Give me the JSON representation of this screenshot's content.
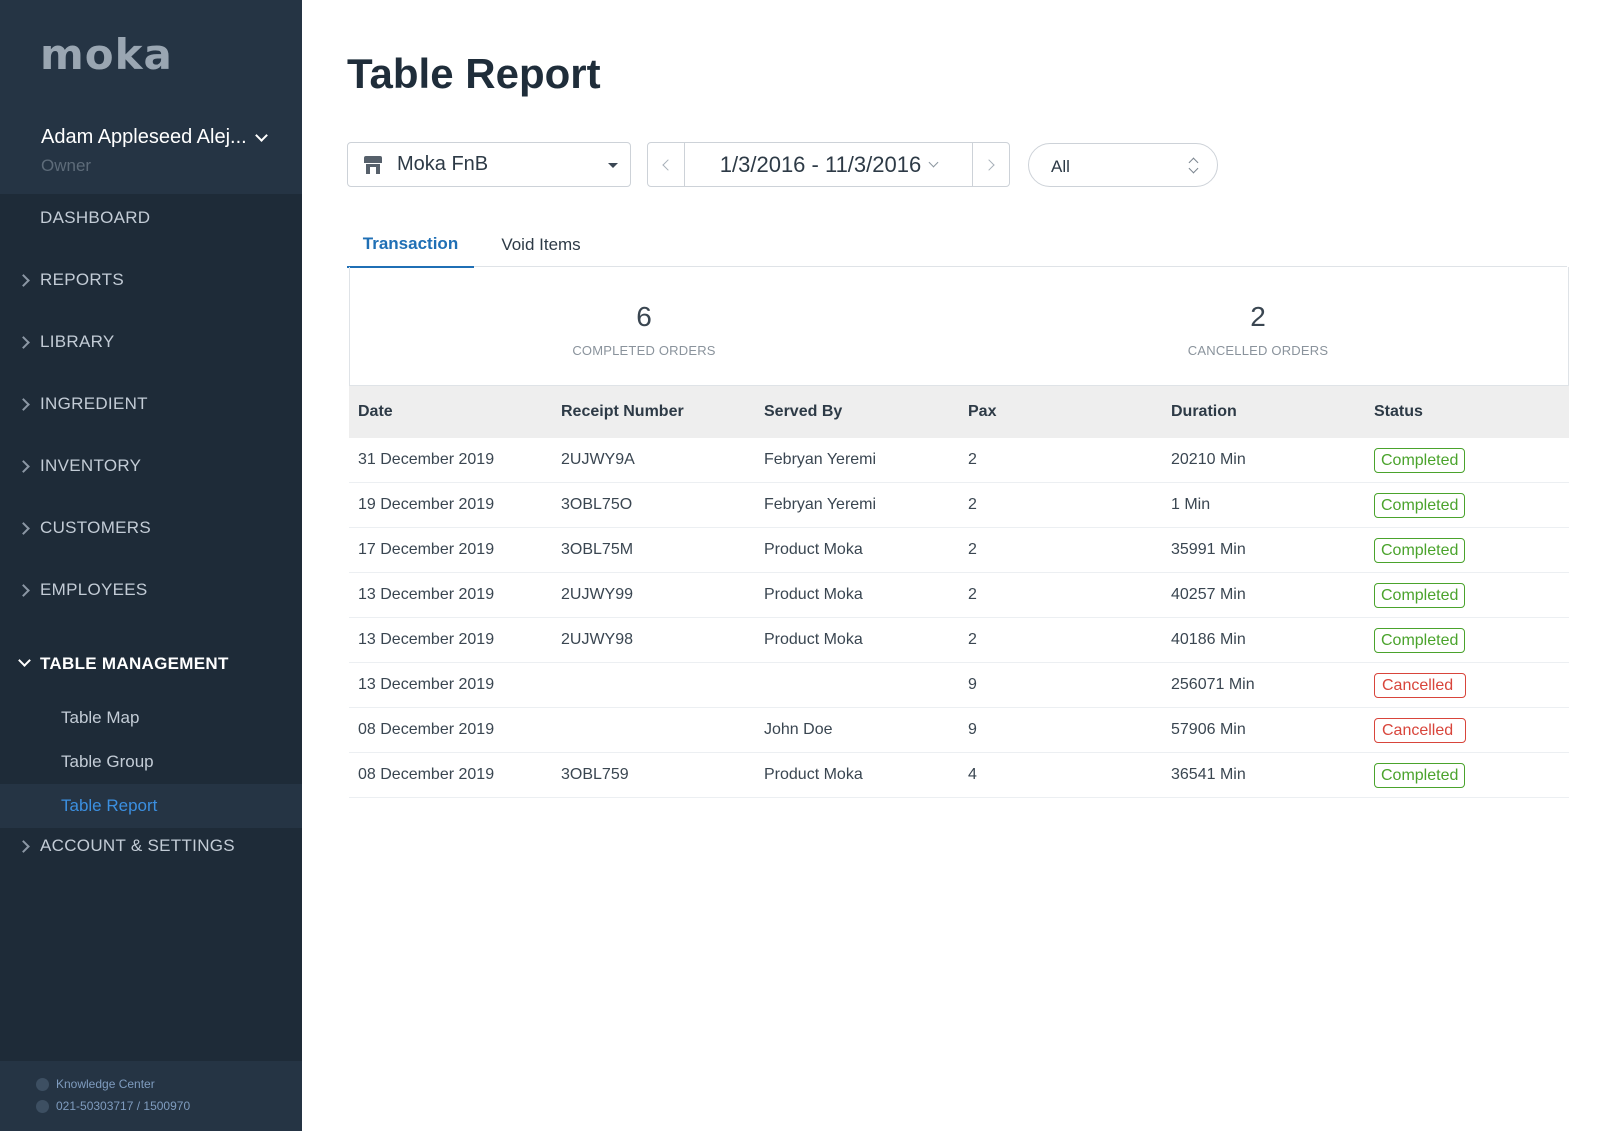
{
  "sidebar": {
    "logo": "moka",
    "user_name": "Adam Appleseed Alej...",
    "user_role": "Owner",
    "nav": {
      "dashboard": "DASHBOARD",
      "reports": "REPORTS",
      "library": "LIBRARY",
      "ingredient": "INGREDIENT",
      "inventory": "INVENTORY",
      "customers": "CUSTOMERS",
      "employees": "EMPLOYEES",
      "table_management": "TABLE MANAGEMENT",
      "table_map": "Table Map",
      "table_group": "Table Group",
      "table_report": "Table Report",
      "account_settings": "ACCOUNT & SETTINGS"
    },
    "footer": {
      "knowledge_center": "Knowledge Center",
      "phone": "021-50303717 / 1500970"
    }
  },
  "main": {
    "title": "Table Report",
    "outlet": "Moka FnB",
    "date_range": "1/3/2016 - 11/3/2016",
    "filter": "All",
    "tabs": {
      "transaction": "Transaction",
      "void_items": "Void Items"
    },
    "summary": {
      "completed_count": "6",
      "completed_label": "COMPLETED ORDERS",
      "cancelled_count": "2",
      "cancelled_label": "CANCELLED ORDERS"
    },
    "columns": {
      "date": "Date",
      "receipt": "Receipt Number",
      "served_by": "Served By",
      "pax": "Pax",
      "duration": "Duration",
      "status": "Status"
    },
    "rows": [
      {
        "date": "31 December 2019",
        "receipt": "2UJWY9A",
        "served_by": "Febryan Yeremi",
        "pax": "2",
        "duration": "20210 Min",
        "status": "Completed"
      },
      {
        "date": "19 December 2019",
        "receipt": "3OBL75O",
        "served_by": "Febryan Yeremi",
        "pax": "2",
        "duration": "1 Min",
        "status": "Completed"
      },
      {
        "date": "17 December 2019",
        "receipt": "3OBL75M",
        "served_by": "Product Moka",
        "pax": "2",
        "duration": "35991 Min",
        "status": "Completed"
      },
      {
        "date": "13 December 2019",
        "receipt": "2UJWY99",
        "served_by": "Product Moka",
        "pax": "2",
        "duration": "40257 Min",
        "status": "Completed"
      },
      {
        "date": "13 December 2019",
        "receipt": "2UJWY98",
        "served_by": "Product Moka",
        "pax": "2",
        "duration": "40186 Min",
        "status": "Completed"
      },
      {
        "date": "13 December 2019",
        "receipt": "",
        "served_by": "",
        "pax": "9",
        "duration": "256071 Min",
        "status": "Cancelled"
      },
      {
        "date": "08 December 2019",
        "receipt": "",
        "served_by": "John Doe",
        "pax": "9",
        "duration": "57906 Min",
        "status": "Cancelled"
      },
      {
        "date": "08 December 2019",
        "receipt": "3OBL759",
        "served_by": "Product Moka",
        "pax": "4",
        "duration": "36541 Min",
        "status": "Completed"
      }
    ]
  },
  "colors": {
    "sidebar_bg": "#1e2b38",
    "accent": "#1f6fb5",
    "completed": "#4aa32c",
    "cancelled": "#d8453b"
  }
}
